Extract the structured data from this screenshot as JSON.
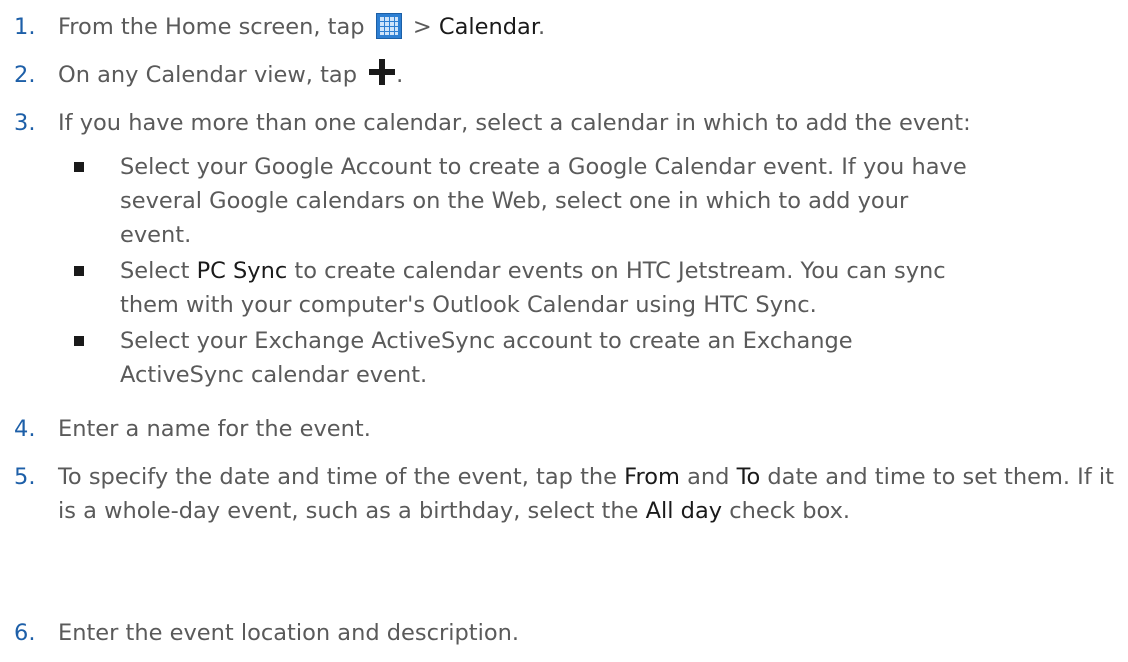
{
  "steps": [
    {
      "num": "1.",
      "pre": "From the Home screen, tap ",
      "mid": " > ",
      "bold": "Calendar",
      "post": "."
    },
    {
      "num": "2.",
      "pre": "On any Calendar view, tap ",
      "post": "."
    },
    {
      "num": "3.",
      "text": "If you have more than one calendar, select a calendar in which to add the event:"
    },
    {
      "num": "4.",
      "text": "Enter a name for the event."
    },
    {
      "num": "5.",
      "pre": "To specify the date and time of the event, tap the ",
      "from": "From",
      "and": " and ",
      "to": "To",
      "mid": " date and time to set them. If it is a whole-day event, such as a birthday, select the ",
      "allday": "All day",
      "post": " check box."
    },
    {
      "num": "6.",
      "text": "Enter the event location and description."
    }
  ],
  "bullets": [
    {
      "line1": "Select your Google Account to create a Google Calendar event. If you have",
      "line2": "several Google calendars on the Web, select one in which to add your",
      "line3": "event."
    },
    {
      "pre": "Select ",
      "bold": "PC Sync",
      "post1": " to create calendar events on HTC Jetstream. You can sync",
      "line2": "them with your computer's Outlook Calendar using HTC Sync."
    },
    {
      "line1": "Select your Exchange ActiveSync account to create an Exchange",
      "line2": "ActiveSync calendar event."
    }
  ],
  "icons": {
    "apps": "all-apps-grid-icon",
    "add": "plus-icon"
  },
  "colors": {
    "number": "#1d5fa8",
    "text": "#5a5a5a",
    "emphasis": "#1a1a1a",
    "apps_icon": "#2d7fd3"
  }
}
